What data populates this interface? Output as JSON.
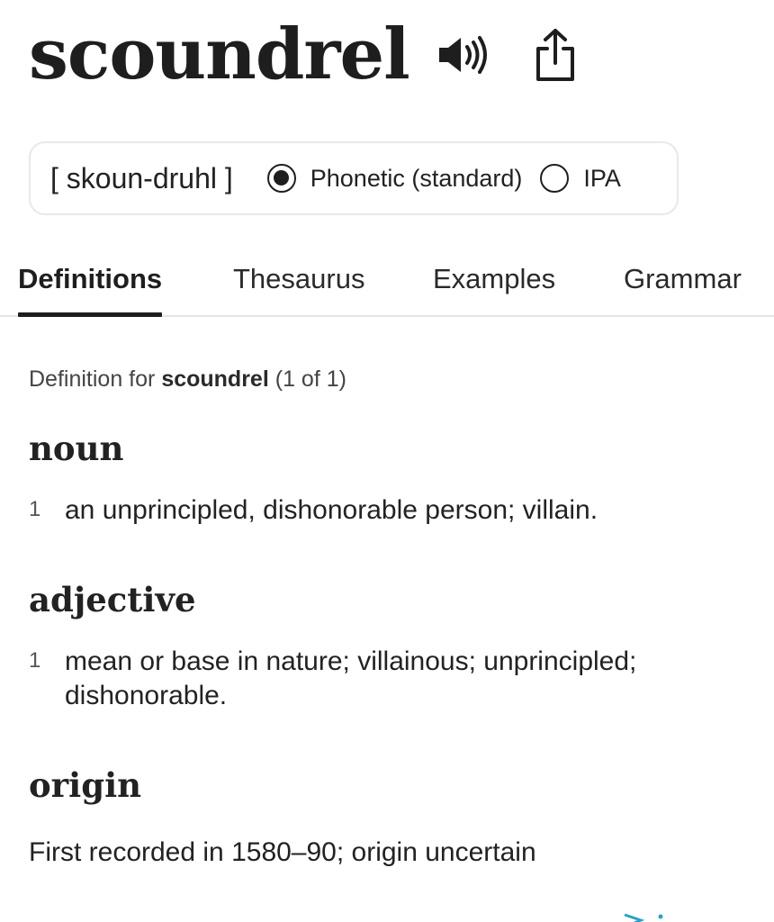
{
  "entry": {
    "headword": "scoundrel",
    "icons": {
      "speaker": "speaker-volume-icon",
      "share": "share-icon"
    }
  },
  "pronunciation": {
    "text": "[ skoun-druhl ]",
    "options": [
      {
        "label": "Phonetic (standard)",
        "selected": true
      },
      {
        "label": "IPA",
        "selected": false
      }
    ]
  },
  "tabs": [
    {
      "label": "Definitions",
      "active": true
    },
    {
      "label": "Thesaurus",
      "active": false
    },
    {
      "label": "Examples",
      "active": false
    },
    {
      "label": "Grammar",
      "active": false
    }
  ],
  "definition_header": {
    "prefix": "Definition for",
    "word": "scoundrel",
    "count": "(1 of 1)"
  },
  "sections": [
    {
      "pos": "noun",
      "senses": [
        {
          "num": "1",
          "text": "an unprincipled, dishonorable person; villain."
        }
      ]
    },
    {
      "pos": "adjective",
      "senses": [
        {
          "num": "1",
          "text": "mean or base in nature; villainous; unprincipled; dishonorable."
        }
      ]
    }
  ],
  "origin": {
    "heading": "origin",
    "text": "First recorded in 1580–90; origin uncertain"
  },
  "colors": {
    "text": "#1e1e1e",
    "border": "#e8e8e8",
    "accent_peek": "#29a3c4"
  }
}
